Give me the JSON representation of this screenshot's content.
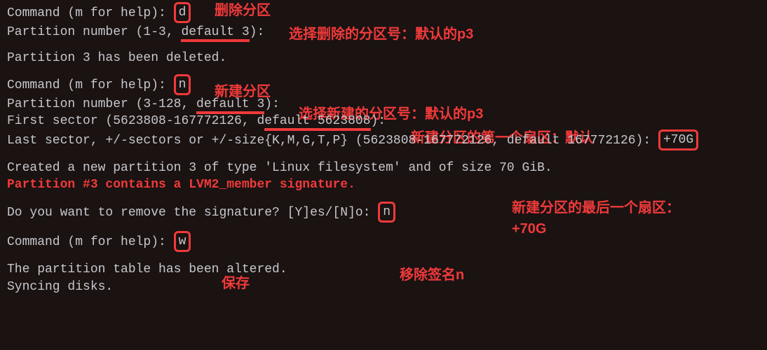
{
  "prompt1": "Command (m for help): ",
  "cmd_d": "d",
  "ann_d": "删除分区",
  "pn1_text": "Partition number (1-3, ",
  "pn1_def": "default 3",
  "pn1_tail": "):",
  "ann_pn1": "选择删除的分区号：默认的p3",
  "deleted": "Partition 3 has been deleted.",
  "prompt2": "Command (m for help): ",
  "cmd_n": "n",
  "ann_n": "新建分区",
  "pn2_text": "Partition number (3-128, ",
  "pn2_def": "default 3",
  "pn2_tail": "):",
  "ann_pn2": "选择新建的分区号：默认的p3",
  "fs_text": "First sector (5623808-167772126, d",
  "fs_def": "efault 5623808",
  "fs_tail": "):",
  "ann_fs": "新建分区的第一个扇区：默认",
  "ls_text": "Last sector, +/-sectors or +/-size{K,M,G,T,P} (5623808-167772126, default 167772126): ",
  "ls_val": "+70G",
  "created": "Created a new partition 3 of type 'Linux filesystem' and of size 70 GiB.",
  "sigwarn": "Partition #3 contains a LVM2_member signature.",
  "ann_ls1": "新建分区的最后一个扇区：",
  "ann_ls2": "+70G",
  "remove_q": "Do you want to remove the signature? [Y]es/[N]o: ",
  "remove_a": "n",
  "ann_remove": "移除签名n",
  "prompt3": "Command (m for help): ",
  "cmd_w": "w",
  "ann_w": "保存",
  "altered": "The partition table has been altered.",
  "syncing": "Syncing disks."
}
